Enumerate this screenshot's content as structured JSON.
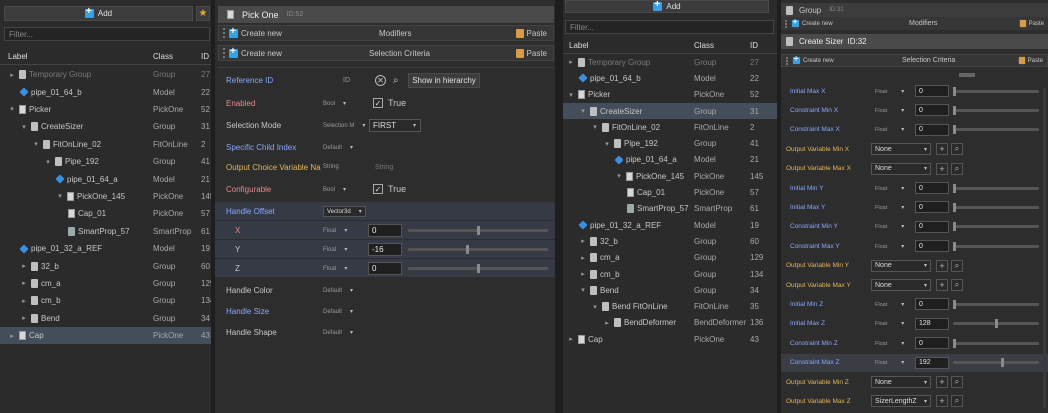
{
  "left_tree": {
    "add_label": "Add",
    "filter_placeholder": "Filter...",
    "columns": {
      "label": "Label",
      "class": "Class",
      "id": "ID"
    },
    "rows": [
      {
        "label": "Temporary Group",
        "class": "Group",
        "id": "27",
        "icon": "group-icon",
        "gray": true
      },
      {
        "label": "pipe_01_64_b",
        "class": "Model",
        "id": "22",
        "icon": "model-icon"
      },
      {
        "label": "Picker",
        "class": "PickOne",
        "id": "52",
        "icon": "pickone-icon"
      },
      {
        "label": "CreateSizer",
        "class": "Group",
        "id": "31",
        "icon": "group-icon"
      },
      {
        "label": "FitOnLine_02",
        "class": "FitOnLine",
        "id": "2",
        "icon": "group-icon"
      },
      {
        "label": "Pipe_192",
        "class": "Group",
        "id": "41",
        "icon": "group-icon"
      },
      {
        "label": "pipe_01_64_a",
        "class": "Model",
        "id": "21",
        "icon": "model-icon"
      },
      {
        "label": "PickOne_145",
        "class": "PickOne",
        "id": "145",
        "icon": "pickone-icon"
      },
      {
        "label": "Cap_01",
        "class": "PickOne",
        "id": "57",
        "icon": "pickone-icon"
      },
      {
        "label": "SmartProp_57",
        "class": "SmartProp",
        "id": "61",
        "icon": "smartprop-icon"
      },
      {
        "label": "pipe_01_32_a_REF",
        "class": "Model",
        "id": "19",
        "icon": "model-icon"
      },
      {
        "label": "32_b",
        "class": "Group",
        "id": "60",
        "icon": "group-icon"
      },
      {
        "label": "cm_a",
        "class": "Group",
        "id": "129",
        "icon": "group-icon"
      },
      {
        "label": "cm_b",
        "class": "Group",
        "id": "134",
        "icon": "group-icon"
      },
      {
        "label": "Bend",
        "class": "Group",
        "id": "34",
        "icon": "group-icon"
      },
      {
        "label": "Cap",
        "class": "PickOne",
        "id": "43",
        "icon": "pickone-icon"
      }
    ]
  },
  "middle": {
    "title": "Pick One",
    "title_id": "ID:52",
    "modifiers": {
      "create": "Create new",
      "title": "Modifiers",
      "paste": "Paste"
    },
    "criteria": {
      "create": "Create new",
      "title": "Selection Criteria",
      "paste": "Paste"
    },
    "reference_id": {
      "label": "Reference ID",
      "type": "ID",
      "show_button": "Show in hierarchy"
    },
    "properties": [
      {
        "label": "Enabled",
        "type": "Bool",
        "value": "True"
      },
      {
        "label": "Selection Mode",
        "type": "Selection M",
        "value": "FIRST"
      },
      {
        "label": "Specific Child Index",
        "type": "Default"
      },
      {
        "label": "Output Choice Variable Na",
        "type": "String",
        "value": "String"
      },
      {
        "label": "Configurable",
        "type": "Bool",
        "value": "True"
      },
      {
        "label": "Handle Offset",
        "type": "Vector3d"
      },
      {
        "label": "X",
        "type": "Float",
        "value": "0",
        "slider": 0.5
      },
      {
        "label": "Y",
        "type": "Float",
        "value": "-16",
        "slider": 0.42
      },
      {
        "label": "Z",
        "type": "Float",
        "value": "0",
        "slider": 0.5
      },
      {
        "label": "Handle Color",
        "type": "Default"
      },
      {
        "label": "Handle Size",
        "type": "Default"
      },
      {
        "label": "Handle Shape",
        "type": "Default"
      }
    ]
  },
  "right_tree": {
    "add_label": "Add",
    "filter_placeholder": "Filter...",
    "columns": {
      "label": "Label",
      "class": "Class",
      "id": "ID"
    },
    "rows": [
      {
        "label": "Temporary Group",
        "class": "Group",
        "id": "27",
        "icon": "group-icon",
        "gray": true
      },
      {
        "label": "pipe_01_64_b",
        "class": "Model",
        "id": "22",
        "icon": "model-icon"
      },
      {
        "label": "Picker",
        "class": "PickOne",
        "id": "52",
        "icon": "pickone-icon"
      },
      {
        "label": "CreateSizer",
        "class": "Group",
        "id": "31",
        "icon": "group-icon"
      },
      {
        "label": "FitOnLine_02",
        "class": "FitOnLine",
        "id": "2",
        "icon": "group-icon"
      },
      {
        "label": "Pipe_192",
        "class": "Group",
        "id": "41",
        "icon": "group-icon"
      },
      {
        "label": "pipe_01_64_a",
        "class": "Model",
        "id": "21",
        "icon": "model-icon"
      },
      {
        "label": "PickOne_145",
        "class": "PickOne",
        "id": "145",
        "icon": "pickone-icon"
      },
      {
        "label": "Cap_01",
        "class": "PickOne",
        "id": "57",
        "icon": "pickone-icon"
      },
      {
        "label": "SmartProp_57",
        "class": "SmartProp",
        "id": "61",
        "icon": "smartprop-icon"
      },
      {
        "label": "pipe_01_32_a_REF",
        "class": "Model",
        "id": "19",
        "icon": "model-icon"
      },
      {
        "label": "32_b",
        "class": "Group",
        "id": "60",
        "icon": "group-icon"
      },
      {
        "label": "cm_a",
        "class": "Group",
        "id": "129",
        "icon": "group-icon"
      },
      {
        "label": "cm_b",
        "class": "Group",
        "id": "134",
        "icon": "group-icon"
      },
      {
        "label": "Bend",
        "class": "Group",
        "id": "34",
        "icon": "group-icon"
      },
      {
        "label": "Bend FitOnLine",
        "class": "FitOnLine",
        "id": "35",
        "icon": "group-icon"
      },
      {
        "label": "BendDeformer",
        "class": "BendDeformer",
        "id": "136",
        "icon": "group-icon"
      },
      {
        "label": "Cap",
        "class": "PickOne",
        "id": "43",
        "icon": "pickone-icon"
      }
    ]
  },
  "far_right": {
    "title": "Group",
    "title_id": "ID:31",
    "modifiers": {
      "create": "Create new",
      "title": "Modifiers",
      "paste": "Paste"
    },
    "sizer_title": "Create Sizer",
    "sizer_id": "ID:32",
    "criteria": {
      "create": "Create new",
      "title": "Selection Criteria",
      "paste": "Paste"
    },
    "properties": [
      {
        "label": "Initial Max X",
        "type": "Float",
        "value": "0",
        "kind": "float",
        "slider": 0.0
      },
      {
        "label": "Constraint Min X",
        "type": "Float",
        "value": "0",
        "kind": "float",
        "slider": 0.0
      },
      {
        "label": "Constraint Max X",
        "type": "Float",
        "value": "0",
        "kind": "float",
        "slider": 0.0
      },
      {
        "label": "Output Variable Min X",
        "value": "None",
        "kind": "select"
      },
      {
        "label": "Output Variable Max X",
        "value": "None",
        "kind": "select"
      },
      {
        "label": "Initial Min Y",
        "type": "Float",
        "value": "0",
        "kind": "float",
        "slider": 0.0
      },
      {
        "label": "Initial Max Y",
        "type": "Float",
        "value": "0",
        "kind": "float",
        "slider": 0.0
      },
      {
        "label": "Constraint Min Y",
        "type": "Float",
        "value": "0",
        "kind": "float",
        "slider": 0.0
      },
      {
        "label": "Constraint Max Y",
        "type": "Float",
        "value": "0",
        "kind": "float",
        "slider": 0.0
      },
      {
        "label": "Output Variable Min Y",
        "value": "None",
        "kind": "select"
      },
      {
        "label": "Output Variable Max Y",
        "value": "None",
        "kind": "select"
      },
      {
        "label": "Initial Min Z",
        "type": "Float",
        "value": "0",
        "kind": "float",
        "slider": 0.0
      },
      {
        "label": "Initial Max Z",
        "type": "Float",
        "value": "128",
        "kind": "float",
        "slider": 0.5
      },
      {
        "label": "Constraint Min Z",
        "type": "Float",
        "value": "0",
        "kind": "float",
        "slider": 0.0
      },
      {
        "label": "Constraint Max Z",
        "type": "Float",
        "value": "192",
        "kind": "float",
        "slider": 0.58
      },
      {
        "label": "Output Variable Min Z",
        "value": "None",
        "kind": "select"
      },
      {
        "label": "Output Variable Max Z",
        "value": "SizerLengthZ",
        "kind": "select"
      }
    ]
  },
  "colors": {
    "accent_blue": "#8aa8ff",
    "accent_yellow": "#e2b75a",
    "accent_pink": "#e58a8a",
    "selection": "#444d5a"
  }
}
